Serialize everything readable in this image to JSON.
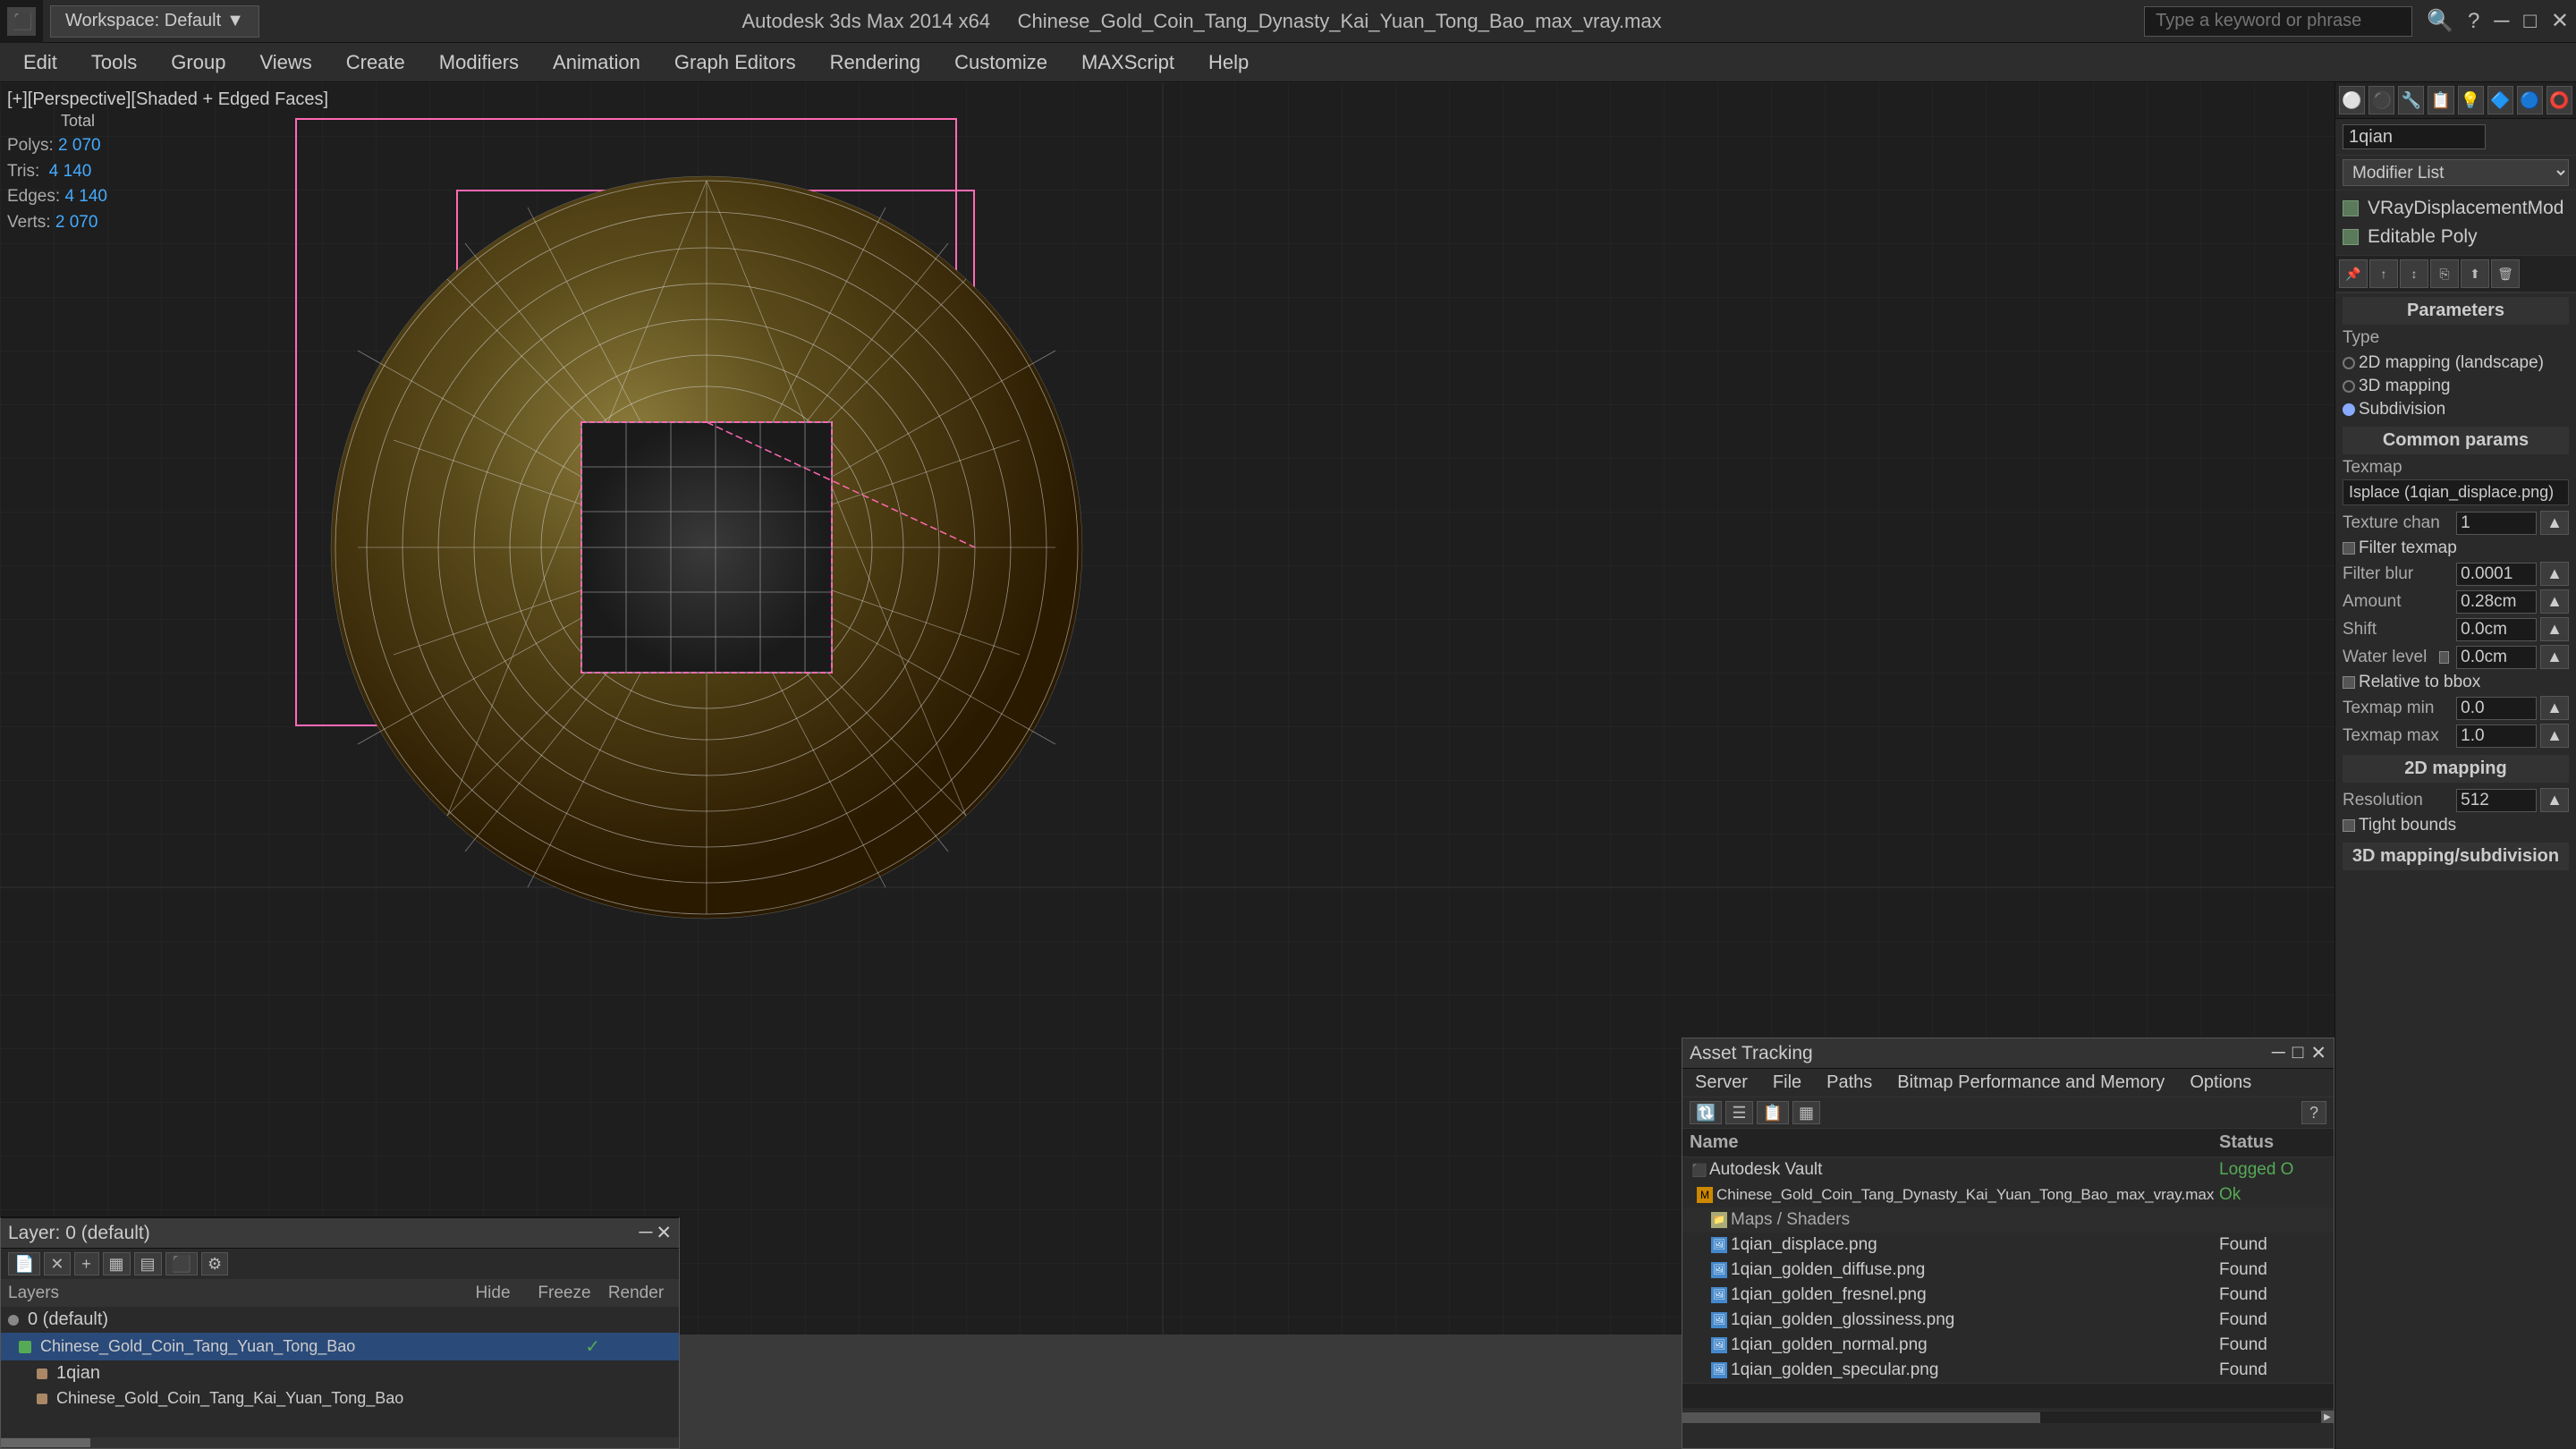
{
  "app": {
    "title": "Autodesk 3ds Max 2014 x64",
    "file": "Chinese_Gold_Coin_Tang_Dynasty_Kai_Yuan_Tong_Bao_max_vray.max",
    "workspace": "Workspace: Default"
  },
  "topbar": {
    "search_placeholder": "Type a keyword or phrase"
  },
  "menubar": {
    "items": [
      "Edit",
      "Tools",
      "Group",
      "Views",
      "Create",
      "Modifiers",
      "Animation",
      "Graph Editors",
      "Rendering",
      "Customize",
      "MAXScript",
      "Help"
    ]
  },
  "viewport": {
    "label": "[+][Perspective][Shaded + Edged Faces]",
    "stats": {
      "polys_label": "Polys:",
      "polys_total_label": "Total",
      "polys_val": "2 070",
      "tris_label": "Tris:",
      "tris_val": "4 140",
      "edges_label": "Edges:",
      "edges_val": "4 140",
      "verts_label": "Verts:",
      "verts_val": "2 070"
    }
  },
  "rightpanel": {
    "name_input": "1qian",
    "modifier_list_label": "Modifier List",
    "modifiers": [
      "VRayDisplacementMod",
      "Editable Poly"
    ],
    "params_title": "Parameters",
    "type_label": "Type",
    "types": [
      "2D mapping (landscape)",
      "3D mapping",
      "Subdivision"
    ],
    "selected_type": "Subdivision",
    "common_params": "Common params",
    "texmap": "Texmap",
    "isplace": "Isplace (1qian_displace.png)",
    "texture_chan_label": "Texture chan",
    "texture_chan_val": "1",
    "filter_texmap": "Filter texmap",
    "filter_blur_label": "Filter blur",
    "filter_blur_val": "0.0001",
    "amount_label": "Amount",
    "amount_val": "0.28cm",
    "shift_label": "Shift",
    "shift_val": "0.0cm",
    "water_level_label": "Water level",
    "water_level_val": "0.0cm",
    "relative_to_bbox": "Relative to bbox",
    "texmap_min_label": "Texmap min",
    "texmap_min_val": "0.0",
    "texmap_max_label": "Texmap max",
    "texmap_max_val": "1.0",
    "2d_mapping": "2D mapping",
    "resolution_label": "Resolution",
    "resolution_val": "512",
    "tight_bounds": "Tight bounds",
    "3d_mapping_subdivision": "3D mapping/subdivision"
  },
  "layers": {
    "title": "Layer: 0 (default)",
    "header_cols": [
      "Layers",
      "Hide",
      "Freeze",
      "Render"
    ],
    "rows": [
      {
        "indent": 0,
        "label": "0 (default)",
        "hide": "",
        "freeze": "",
        "render": "",
        "selected": false,
        "icon": "layer"
      },
      {
        "indent": 1,
        "label": "Chinese_Gold_Coin_Tang_Yuan_Tong_Bao",
        "hide": "",
        "freeze": "",
        "render": "",
        "selected": true,
        "icon": "layer-active"
      },
      {
        "indent": 2,
        "label": "1qian",
        "hide": "",
        "freeze": "",
        "render": "",
        "selected": false,
        "icon": "object"
      },
      {
        "indent": 2,
        "label": "Chinese_Gold_Coin_Tang_Kai_Yuan_Tong_Bao",
        "hide": "",
        "freeze": "",
        "render": "",
        "selected": false,
        "icon": "object"
      }
    ]
  },
  "asset_tracking": {
    "title": "Asset Tracking",
    "menu": [
      "Server",
      "File",
      "Paths",
      "Bitmap Performance and Memory",
      "Options"
    ],
    "cols": [
      "Name",
      "Status"
    ],
    "rows": [
      {
        "indent": 0,
        "type": "vault",
        "label": "Autodesk Vault",
        "status": "Logged O"
      },
      {
        "indent": 1,
        "type": "file",
        "label": "Chinese_Gold_Coin_Tang_Dynasty_Kai_Yuan_Tong_Bao_max_vray.max",
        "status": "Ok"
      },
      {
        "indent": 2,
        "type": "folder",
        "label": "Maps / Shaders",
        "status": ""
      },
      {
        "indent": 3,
        "type": "img",
        "label": "1qian_displace.png",
        "status": "Found"
      },
      {
        "indent": 3,
        "type": "img",
        "label": "1qian_golden_diffuse.png",
        "status": "Found"
      },
      {
        "indent": 3,
        "type": "img",
        "label": "1qian_golden_fresnel.png",
        "status": "Found"
      },
      {
        "indent": 3,
        "type": "img",
        "label": "1qian_golden_glossiness.png",
        "status": "Found"
      },
      {
        "indent": 3,
        "type": "img",
        "label": "1qian_golden_normal.png",
        "status": "Found"
      },
      {
        "indent": 3,
        "type": "img",
        "label": "1qian_golden_specular.png",
        "status": "Found"
      }
    ]
  }
}
